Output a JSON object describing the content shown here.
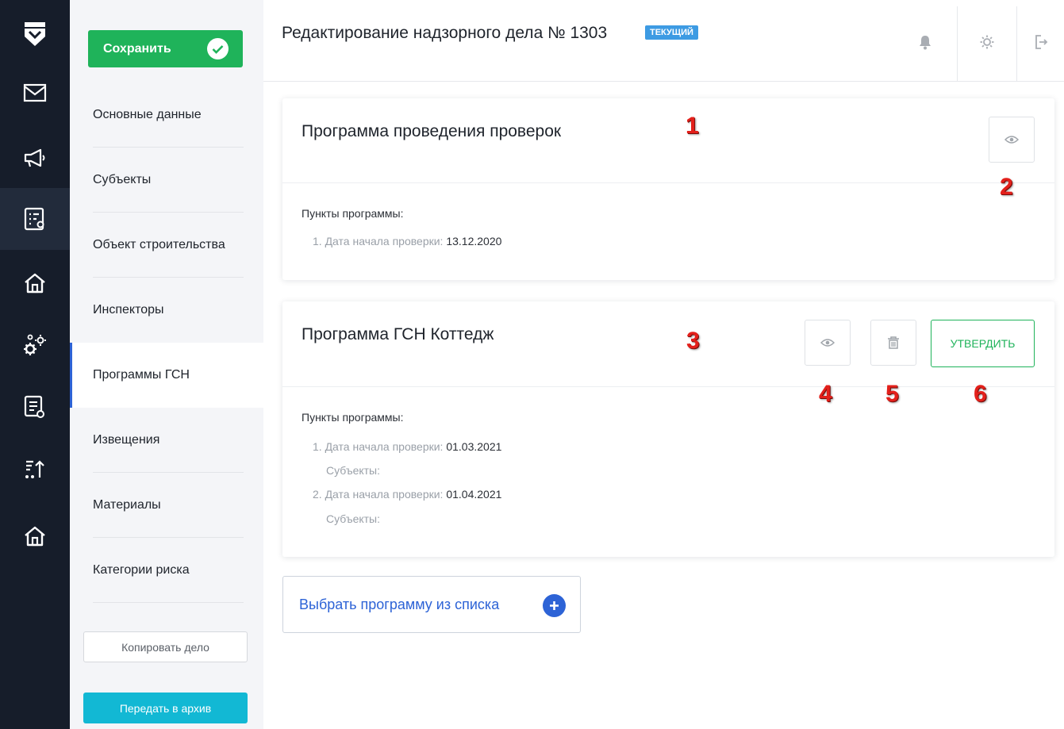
{
  "rail": {
    "icons": [
      "logo-icon",
      "mail-icon",
      "megaphone-icon",
      "case-list-icon",
      "home-icon",
      "gears-icon",
      "report-icon",
      "sort-icon",
      "home-icon"
    ]
  },
  "nav": {
    "save_label": "Сохранить",
    "items": [
      {
        "label": "Основные данные"
      },
      {
        "label": "Субъекты"
      },
      {
        "label": "Объект строительства"
      },
      {
        "label": "Инспекторы"
      },
      {
        "label": "Программы ГСН"
      },
      {
        "label": "Извещения"
      },
      {
        "label": "Материалы"
      },
      {
        "label": "Категории риска"
      }
    ],
    "active_item": "Программы ГСН",
    "copy_label": "Копировать дело",
    "archive_label": "Передать в архив"
  },
  "header": {
    "title": "Редактирование надзорного дела № 1303",
    "badge": "ТЕКУЩИЙ",
    "icons": [
      "bell-icon",
      "gear-icon",
      "logout-icon"
    ]
  },
  "cards": [
    {
      "title": "Программа проведения проверок",
      "items_label": "Пункты программы:",
      "items": [
        {
          "num": "1.",
          "label": "Дата начала проверки:",
          "date": "13.12.2020"
        }
      ]
    },
    {
      "title": "Программа ГСН Коттедж",
      "approve_label": "УТВЕРДИТЬ",
      "items_label": "Пункты программы:",
      "items": [
        {
          "num": "1.",
          "label": "Дата начала проверки:",
          "date": "01.03.2021",
          "subjects_label": "Субъекты:"
        },
        {
          "num": "2.",
          "label": "Дата начала проверки:",
          "date": "01.04.2021",
          "subjects_label": "Субъекты:"
        }
      ]
    }
  ],
  "pick_program_label": "Выбрать программу из списка",
  "callouts": [
    "1",
    "2",
    "3",
    "4",
    "5",
    "6"
  ],
  "colors": {
    "rail_bg": "#161d2a",
    "save_green": "#1fb35a",
    "badge_blue": "#3d9be3",
    "accent_blue": "#2d63d6",
    "archive_cyan": "#12b8d4",
    "callout_red": "#e3201b"
  }
}
